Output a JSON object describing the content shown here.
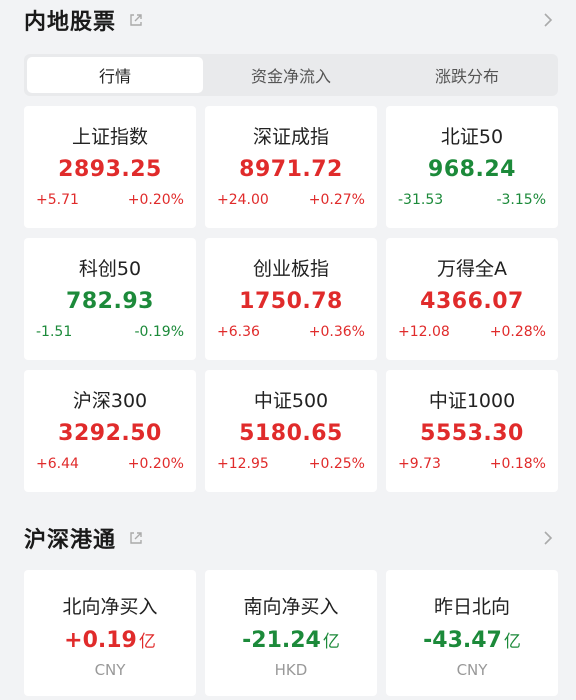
{
  "mainland": {
    "title": "内地股票",
    "tabs": [
      {
        "label": "行情",
        "active": true
      },
      {
        "label": "资金净流入",
        "active": false
      },
      {
        "label": "涨跌分布",
        "active": false
      }
    ],
    "indices": [
      {
        "name": "上证指数",
        "value": "2893.25",
        "change": "+5.71",
        "pct": "+0.20%",
        "trend": "up"
      },
      {
        "name": "深证成指",
        "value": "8971.72",
        "change": "+24.00",
        "pct": "+0.27%",
        "trend": "up"
      },
      {
        "name": "北证50",
        "value": "968.24",
        "change": "-31.53",
        "pct": "-3.15%",
        "trend": "down"
      },
      {
        "name": "科创50",
        "value": "782.93",
        "change": "-1.51",
        "pct": "-0.19%",
        "trend": "down"
      },
      {
        "name": "创业板指",
        "value": "1750.78",
        "change": "+6.36",
        "pct": "+0.36%",
        "trend": "up"
      },
      {
        "name": "万得全A",
        "value": "4366.07",
        "change": "+12.08",
        "pct": "+0.28%",
        "trend": "up"
      },
      {
        "name": "沪深300",
        "value": "3292.50",
        "change": "+6.44",
        "pct": "+0.20%",
        "trend": "up"
      },
      {
        "name": "中证500",
        "value": "5180.65",
        "change": "+12.95",
        "pct": "+0.25%",
        "trend": "up"
      },
      {
        "name": "中证1000",
        "value": "5553.30",
        "change": "+9.73",
        "pct": "+0.18%",
        "trend": "up"
      }
    ]
  },
  "connect": {
    "title": "沪深港通",
    "flows": [
      {
        "name": "北向净买入",
        "value": "+0.19",
        "unit": "亿",
        "currency": "CNY",
        "trend": "up"
      },
      {
        "name": "南向净买入",
        "value": "-21.24",
        "unit": "亿",
        "currency": "HKD",
        "trend": "down"
      },
      {
        "name": "昨日北向",
        "value": "-43.47",
        "unit": "亿",
        "currency": "CNY",
        "trend": "down"
      }
    ]
  },
  "colors": {
    "up": "#e02b2b",
    "down": "#1c8a3a"
  },
  "icons": {
    "share": "share-external-icon",
    "more": "chevron-right-icon"
  }
}
